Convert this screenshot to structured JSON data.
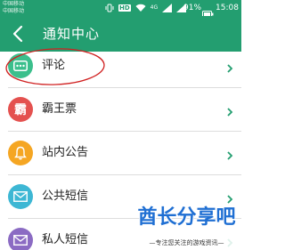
{
  "status_bar": {
    "carrier_1": "中国移动",
    "carrier_2": "中国移动",
    "hd_badge": "HD",
    "network": "4G",
    "battery_percent": "91%",
    "time": "15:08",
    "icons": [
      "vibrate-icon",
      "hd-icon",
      "wifi-icon",
      "signal-icon",
      "battery-icon"
    ]
  },
  "app_bar": {
    "title": "通知中心",
    "back_icon": "back-arrow-icon"
  },
  "list": {
    "items": [
      {
        "label": "评论",
        "icon": "comment-icon",
        "glyph": "",
        "color": "#3bbf8c",
        "highlighted": true
      },
      {
        "label": "霸王票",
        "icon": "ticket-icon",
        "glyph": "霸",
        "color": "#e4514f"
      },
      {
        "label": "站内公告",
        "icon": "bell-icon",
        "glyph": "",
        "color": "#f5a623"
      },
      {
        "label": "公共短信",
        "icon": "mail-icon",
        "glyph": "",
        "color": "#3db7d4"
      },
      {
        "label": "私人短信",
        "icon": "private-mail-icon",
        "glyph": "",
        "color": "#8b6bc3"
      }
    ],
    "chevron_color": "#239e70"
  },
  "watermark": {
    "title": "酋长分享吧",
    "subtitle": "—专注您关注的游戏资讯—"
  },
  "colors": {
    "primary": "#239e70",
    "highlight_ring": "#d02020"
  }
}
